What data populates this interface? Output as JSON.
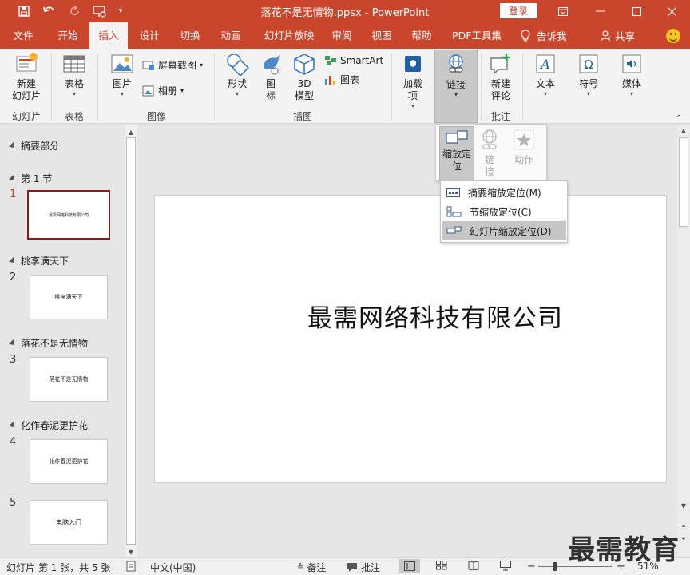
{
  "window": {
    "title": "落花不是无情物.ppsx  -  PowerPoint",
    "login_label": "登录"
  },
  "tabs": [
    "文件",
    "开始",
    "插入",
    "设计",
    "切换",
    "动画",
    "幻灯片放映",
    "审阅",
    "视图",
    "帮助",
    "PDF工具集"
  ],
  "active_tab": "插入",
  "tell_me": "告诉我",
  "share": "共享",
  "ribbon": {
    "new_slide": "新建\n幻灯片",
    "new_slide_l1": "新建",
    "new_slide_l2": "幻灯片",
    "table": "表格",
    "picture": "图片",
    "screenshot": "屏幕截图",
    "album": "相册",
    "shapes": "形状",
    "icons_l1": "图",
    "icons_l2": "标",
    "model3d_l1": "3D",
    "model3d_l2": "模型",
    "smartart": "SmartArt",
    "chart": "图表",
    "addins_l1": "加载",
    "addins_l2": "项",
    "link": "链接",
    "new_comment_l1": "新建",
    "new_comment_l2": "评论",
    "text": "文本",
    "symbol": "符号",
    "media": "媒体",
    "groups": {
      "slides": "幻灯片",
      "tables": "表格",
      "images": "图像",
      "illustrations": "插图",
      "comments": "批注"
    }
  },
  "link_dropdown": {
    "zoom_l1": "缩放定",
    "zoom_l2": "位",
    "link_l1": "链",
    "link_l2": "接",
    "action": "动作"
  },
  "zoom_menu": [
    "摘要缩放定位(M)",
    "节缩放定位(C)",
    "幻灯片缩放定位(D)"
  ],
  "panel": {
    "sections": [
      "摘要部分",
      "第 1 节",
      "桃李满天下",
      "落花不是无情物",
      "化作春泥更护花"
    ],
    "slides": [
      {
        "num": "1",
        "text": "最需网络科技有限公司"
      },
      {
        "num": "2",
        "text": "桃李满天下"
      },
      {
        "num": "3",
        "text": "落花不是无情物"
      },
      {
        "num": "4",
        "text": "化作春泥更护花"
      },
      {
        "num": "5",
        "text": "电脑入门"
      }
    ]
  },
  "slide": {
    "title": "最需网络科技有限公司"
  },
  "status": {
    "slide_info": "幻灯片 第 1 张，共 5 张",
    "language": "中文(中国)",
    "notes": "备注",
    "comments": "批注",
    "zoom": "51%"
  },
  "watermark": "最需教育",
  "colors": {
    "accent": "#c9452b",
    "selected_border": "#8b1a1a"
  }
}
